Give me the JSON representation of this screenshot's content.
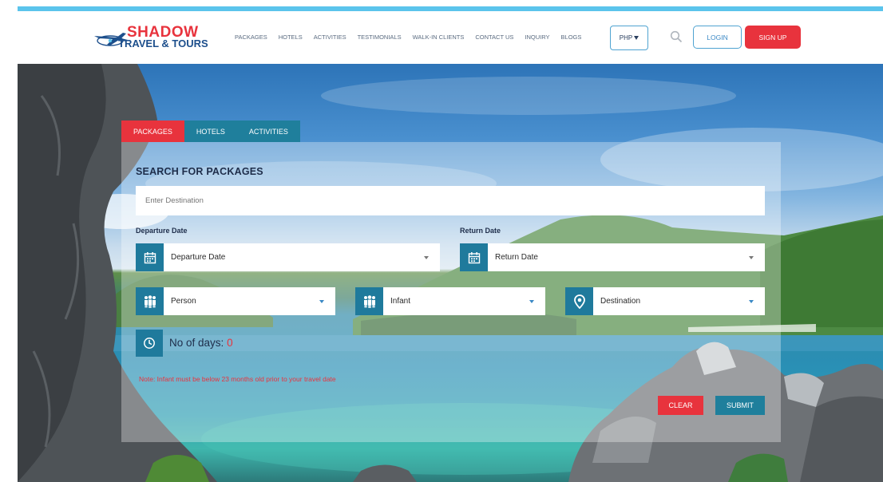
{
  "header": {
    "brand_name": "SHADOW",
    "brand_sub": "TRAVEL & TOURS",
    "nav": [
      "PACKAGES",
      "HOTELS",
      "ACTIVITIES",
      "TESTIMONIALS",
      "WALK-IN CLIENTS",
      "CONTACT US",
      "INQUIRY",
      "BLOGS"
    ],
    "currency": "PHP",
    "login_label": "LOGIN",
    "signup_label": "SIGN UP"
  },
  "search": {
    "tabs": [
      {
        "label": "PACKAGES",
        "active": true
      },
      {
        "label": "HOTELS",
        "active": false
      },
      {
        "label": "ACTIVITIES",
        "active": false
      }
    ],
    "title": "SEARCH FOR PACKAGES",
    "destination_placeholder": "Enter Destination",
    "departure_label": "Departure Date",
    "departure_value": "Departure Date",
    "return_label": "Return Date",
    "return_value": "Return Date",
    "person_value": "Person",
    "infant_value": "Infant",
    "destination_value": "Destination",
    "days_label": "No of days:",
    "days_value": "0",
    "note": "Note: Infant must be below 23 months old prior to your travel date",
    "clear_label": "CLEAR",
    "submit_label": "SUBMIT"
  },
  "colors": {
    "accent_red": "#e8333d",
    "teal": "#1f7f9c",
    "top_line": "#5bc4ec",
    "brand_blue": "#1d4f8c"
  },
  "icons": [
    "plane-logo-icon",
    "search-icon",
    "calendar-icon",
    "people-icon",
    "location-pin-icon",
    "clock-icon",
    "caret-down-icon"
  ]
}
